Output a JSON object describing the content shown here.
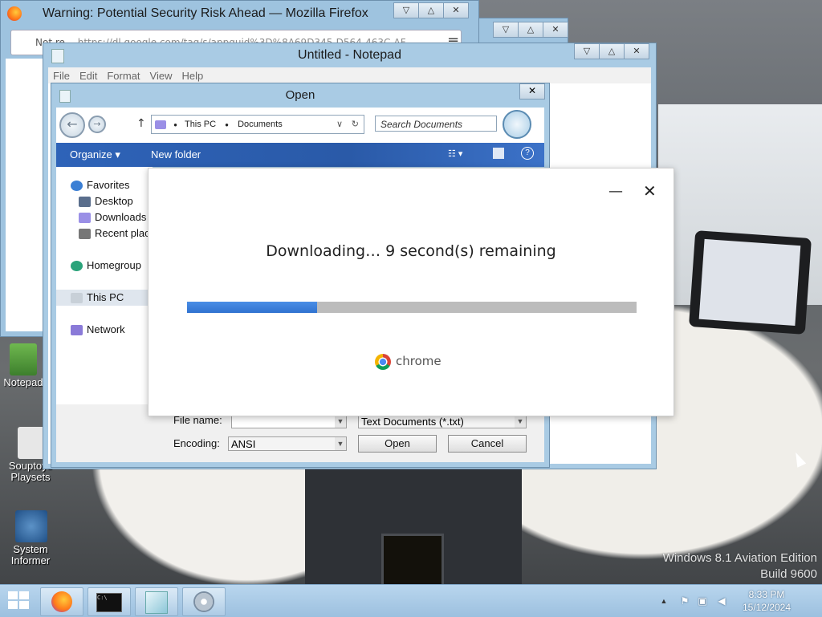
{
  "desktop": {
    "watermark_line1": "Windows 8.1 Aviation Edition",
    "watermark_line2": "Build 9600",
    "icons": [
      {
        "label": "Notepad"
      },
      {
        "label": "Souptoys Playsets"
      },
      {
        "label": "System Informer"
      }
    ]
  },
  "firefox": {
    "title": "Warning: Potential Security Risk Ahead — Mozilla Firefox",
    "url_prefix": "Not re",
    "url": "https://dl.google.com/tag/s/appguid%3D%8A69D345-D564-463C-AF",
    "menu_icon": "≡",
    "caption": [
      "▽",
      "△",
      "✕"
    ]
  },
  "background_window": {
    "caption": [
      "▽",
      "△",
      "✕"
    ]
  },
  "notepad": {
    "title": "Untitled - Notepad",
    "menu": [
      "File",
      "Edit",
      "Format",
      "View",
      "Help"
    ],
    "caption": [
      "▽",
      "△",
      "✕"
    ]
  },
  "open_dialog": {
    "title": "Open",
    "close": "✕",
    "address": {
      "part1": "This PC",
      "part2": "Documents"
    },
    "search_placeholder": "Search Documents",
    "toolbar": {
      "organize": "Organize ▾",
      "new_folder": "New folder",
      "help": "?"
    },
    "nav": {
      "favorites": "Favorites",
      "desktop": "Desktop",
      "downloads": "Downloads",
      "recent": "Recent places",
      "homegroup": "Homegroup",
      "this_pc": "This PC",
      "network": "Network"
    },
    "file_name_label": "File name:",
    "file_name_value": "",
    "file_type": "Text Documents (*.txt)",
    "encoding_label": "Encoding:",
    "encoding_value": "ANSI",
    "open_button": "Open",
    "cancel_button": "Cancel"
  },
  "download": {
    "minimize": "—",
    "close": "✕",
    "message": "Downloading… 9 second(s) remaining",
    "progress_fraction": 0.29,
    "brand": "chrome"
  },
  "taskbar": {
    "time": "8:33 PM",
    "date": "15/12/2024",
    "tray_up": "▲"
  },
  "colors": {
    "progress": "#2f72d0",
    "toolbar_blue": "#2a5aa8"
  }
}
